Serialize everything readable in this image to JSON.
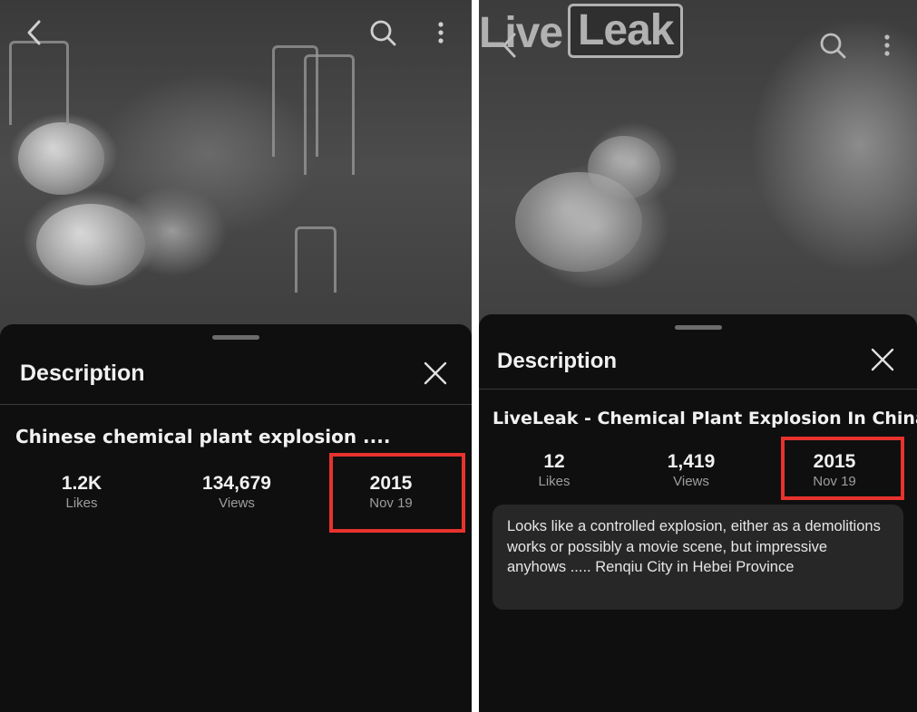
{
  "panels": [
    {
      "icons": {
        "back": "chevron-left-icon",
        "search": "search-icon",
        "menu": "more-vertical-icon",
        "close": "close-icon"
      },
      "sheet": {
        "title": "Description",
        "video_title": "Chinese chemical plant explosion ....",
        "stats": {
          "likes_value": "1.2K",
          "likes_label": "Likes",
          "views_value": "134,679",
          "views_label": "Views",
          "year": "2015",
          "date": "Nov 19"
        }
      }
    },
    {
      "watermark": {
        "part1": "Live",
        "part2": "Leak"
      },
      "icons": {
        "back": "chevron-left-icon",
        "search": "search-icon",
        "menu": "more-vertical-icon",
        "close": "close-icon"
      },
      "sheet": {
        "title": "Description",
        "video_title": "LiveLeak - Chemical Plant Explosion In China",
        "stats": {
          "likes_value": "12",
          "likes_label": "Likes",
          "views_value": "1,419",
          "views_label": "Views",
          "year": "2015",
          "date": "Nov 19"
        },
        "description": "Looks like a controlled explosion, either as a demolitions works or possibly a movie scene, but impressive anyhows ..... Renqiu City in Hebei Province"
      }
    }
  ],
  "colors": {
    "highlight": "#e8322e",
    "sheet_bg": "#0f0f0f",
    "desc_bg": "#272727"
  }
}
